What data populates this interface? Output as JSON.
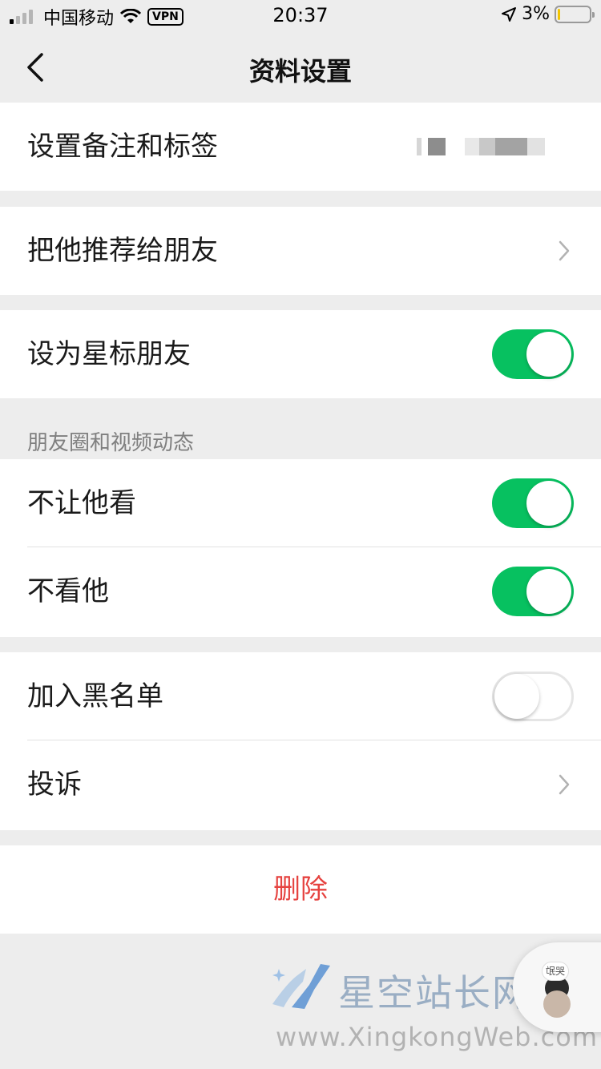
{
  "status_bar": {
    "carrier": "中国移动",
    "vpn": "VPN",
    "time": "20:37",
    "battery_percent": "3%",
    "battery_level": 0.03,
    "battery_color": "#f2c500"
  },
  "nav": {
    "title": "资料设置",
    "back_icon": "chevron-left-icon"
  },
  "rows": {
    "remark": {
      "label": "设置备注和标签"
    },
    "recommend": {
      "label": "把他推荐给朋友"
    },
    "star": {
      "label": "设为星标朋友",
      "on": true
    }
  },
  "moments_section": {
    "header": "朋友圈和视频动态",
    "hide_my_posts": {
      "label": "不让他看",
      "on": true
    },
    "hide_his_posts": {
      "label": "不看他",
      "on": true
    }
  },
  "privacy": {
    "blacklist": {
      "label": "加入黑名单",
      "on": false
    },
    "report": {
      "label": "投诉"
    }
  },
  "delete": {
    "label": "删除",
    "color": "#e64340"
  },
  "colors": {
    "toggle_on": "#07c160",
    "background": "#ededed"
  },
  "watermark": {
    "cn": "星空站长网",
    "en": "www.XingkongWeb.com"
  },
  "floating_widget": {
    "bubble": "氓哭"
  }
}
